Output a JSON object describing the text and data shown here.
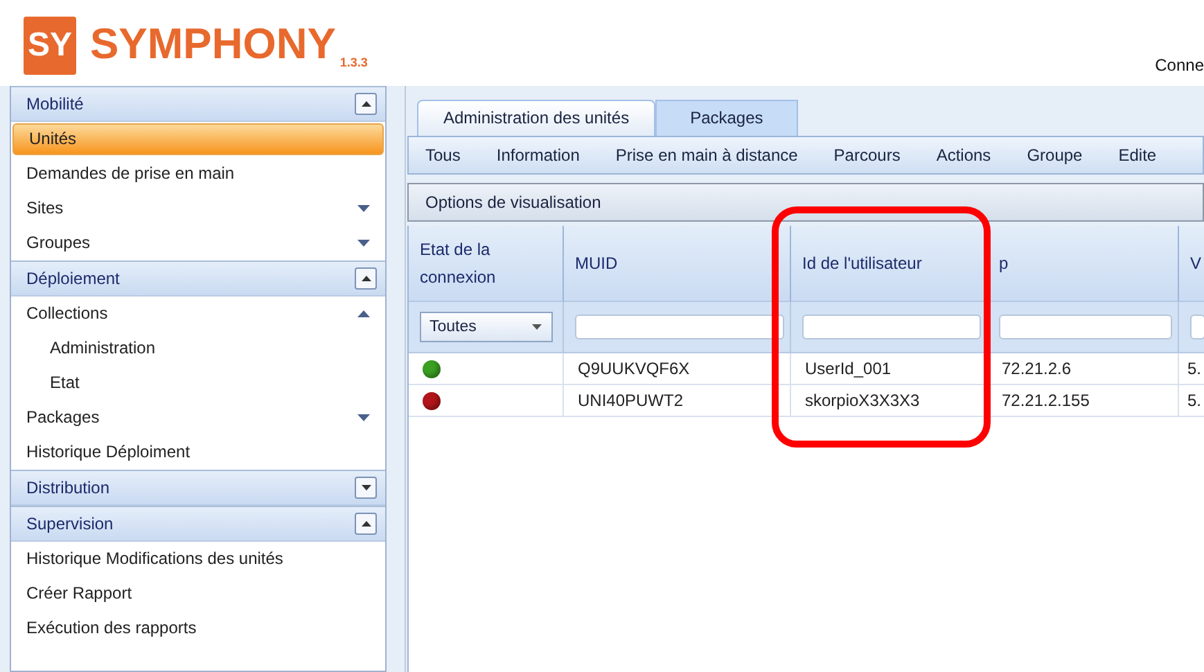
{
  "logo": {
    "mark": "SY",
    "name": "SYMPHONY",
    "version": "1.3.3"
  },
  "header_right": "Conne",
  "sidebar": {
    "sections": [
      {
        "title": "Mobilité",
        "expanded": true,
        "items": [
          {
            "label": "Unités",
            "selected": true
          },
          {
            "label": "Demandes de prise en main",
            "selected": false
          },
          {
            "label": "Sites",
            "selected": false,
            "expanded": false
          },
          {
            "label": "Groupes",
            "selected": false,
            "expanded": false
          }
        ]
      },
      {
        "title": "Déploiement",
        "expanded": true,
        "items": [
          {
            "label": "Collections",
            "selected": false,
            "expanded": true,
            "children": [
              {
                "label": "Administration",
                "selected": false
              },
              {
                "label": "Etat",
                "selected": false
              }
            ]
          },
          {
            "label": "Packages",
            "selected": false,
            "expanded": false
          },
          {
            "label": "Historique Déploiment",
            "selected": false
          }
        ]
      },
      {
        "title": "Distribution",
        "expanded": false
      },
      {
        "title": "Supervision",
        "expanded": true,
        "items": [
          {
            "label": "Historique Modifications des unités",
            "selected": false
          },
          {
            "label": "Créer Rapport",
            "selected": false
          },
          {
            "label": "Exécution des rapports",
            "selected": false
          }
        ]
      }
    ]
  },
  "tabs": [
    {
      "label": "Administration des unités",
      "selected": true
    },
    {
      "label": "Packages",
      "selected": false
    }
  ],
  "menu": [
    "Tous",
    "Information",
    "Prise en main à distance",
    "Parcours",
    "Actions",
    "Groupe",
    "Edite"
  ],
  "options_bar": "Options de visualisation",
  "table": {
    "columns": [
      "Etat de la connexion",
      "MUID",
      "Id de l'utilisateur",
      "p",
      "V"
    ],
    "status_filter": "Toutes",
    "rows": [
      {
        "color": "#3aa021",
        "cells": [
          "",
          "Q9UUKVQF6X",
          "UserId_001",
          "72.21.2.6",
          "5."
        ]
      },
      {
        "color": "#b3161a",
        "cells": [
          "",
          "UNI40PUWT2",
          "skorpioX3X3X3",
          "72.21.2.155",
          "5."
        ]
      }
    ]
  },
  "highlight": {
    "visible": true
  }
}
